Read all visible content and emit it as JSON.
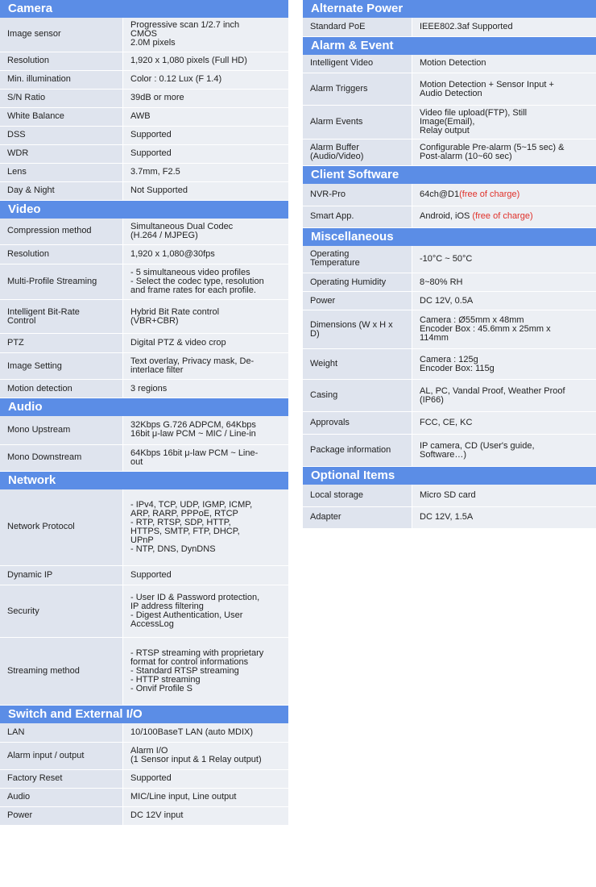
{
  "left_sections": [
    {
      "title": "Camera",
      "rows": [
        {
          "label": "Image sensor",
          "value": "Progressive scan 1/2.7 inch\nCMOS\n2.0M pixels",
          "h": 42
        },
        {
          "label": "Resolution",
          "value": "1,920 x 1,080 pixels (Full HD)",
          "h": 23
        },
        {
          "label": "Min. illumination",
          "value": "Color : 0.12 Lux (F 1.4)",
          "h": 23
        },
        {
          "label": "S/N Ratio",
          "value": "39dB or more",
          "h": 23
        },
        {
          "label": "White Balance",
          "value": "AWB",
          "h": 23
        },
        {
          "label": "DSS",
          "value": "Supported",
          "h": 23
        },
        {
          "label": "WDR",
          "value": "Supported",
          "h": 23
        },
        {
          "label": "Lens",
          "value": "3.7mm,  F2.5",
          "h": 23
        },
        {
          "label": "Day & Night",
          "value": "Not Supported",
          "h": 23
        }
      ]
    },
    {
      "title": "Video",
      "rows": [
        {
          "label": "Compression method",
          "value": "Simultaneous Dual Codec\n (H.264 / MJPEG)",
          "h": 33
        },
        {
          "label": "Resolution",
          "value": "1,920 x 1,080@30fps",
          "h": 24
        },
        {
          "label": "Multi-Profile Streaming",
          "value": "- 5 simultaneous video profiles\n- Select the codec type, resolution\n  and frame rates for each profile.",
          "h": 44
        },
        {
          "label": "Intelligent Bit-Rate\nControl",
          "value": "Hybrid Bit Rate control\n(VBR+CBR)",
          "h": 42
        },
        {
          "label": "PTZ",
          "value": "Digital PTZ  &  video crop",
          "h": 24
        },
        {
          "label": "Image Setting",
          "value": "Text overlay, Privacy mask, De-\ninterlace filter",
          "h": 33
        },
        {
          "label": "Motion detection",
          "value": "3 regions",
          "h": 23
        }
      ]
    },
    {
      "title": "Audio",
      "rows": [
        {
          "label": "Mono Upstream",
          "value": "32Kbps G.726 ADPCM, 64Kbps\n16bit μ-law PCM  ~ MIC / Line-in",
          "h": 35
        },
        {
          "label": "Mono Downstream",
          "value": "64Kbps 16bit μ-law PCM ~ Line-\nout",
          "h": 33
        }
      ]
    },
    {
      "title": "Network",
      "rows": [
        {
          "label": "Network Protocol",
          "value": "- IPv4,  TCP,  UDP,  IGMP,  ICMP,\n  ARP,  RARP,  PPPoE,  RTCP\n- RTP,  RTSP,  SDP,  HTTP,\n  HTTPS,  SMTP,  FTP,  DHCP,\n  UPnP\n- NTP,  DNS,  DynDNS",
          "h": 95
        },
        {
          "label": "Dynamic IP",
          "value": "Supported",
          "h": 24
        },
        {
          "label": "Security",
          "value": "- User ID  & Password protection,\n  IP address filtering\n- Digest Authentication, User\n  AccessLog",
          "h": 65
        },
        {
          "label": "Streaming method",
          "value": "- RTSP  streaming with proprietary\n  format for control informations\n- Standard RTSP  streaming\n- HTTP  streaming\n- Onvif Profile  S",
          "h": 84
        }
      ]
    },
    {
      "title": "Switch and External I/O",
      "rows": [
        {
          "label": "LAN",
          "value": "10/100BaseT LAN (auto MDIX)",
          "h": 23
        },
        {
          "label": "Alarm input / output",
          "value": "Alarm I/O\n(1 Sensor input & 1 Relay output)",
          "h": 34
        },
        {
          "label": "Factory Reset",
          "value": "Supported",
          "h": 23
        },
        {
          "label": "Audio",
          "value": "MIC/Line  input, Line output",
          "h": 23
        },
        {
          "label": "Power",
          "value": "DC  12V input",
          "h": 23
        }
      ]
    }
  ],
  "right_sections": [
    {
      "title": "Alternate Power",
      "rows": [
        {
          "label": "Standard PoE",
          "value": "IEEE802.3af  Supported",
          "h": 23
        }
      ]
    },
    {
      "title": "Alarm & Event",
      "rows": [
        {
          "label": "Intelligent Video",
          "value": "Motion Detection",
          "h": 23
        },
        {
          "label": "Alarm Triggers",
          "value": "Motion Detection + Sensor Input +\nAudio Detection",
          "h": 40
        },
        {
          "label": "Alarm Events",
          "value": "Video file upload(FTP),  Still\nImage(Email),\nRelay output",
          "h": 42
        },
        {
          "label": "Alarm Buffer\n(Audio/Video)",
          "value": "Configurable Pre-alarm (5~15 sec) &\nPost-alarm (10~60 sec)",
          "h": 33
        }
      ]
    },
    {
      "title": "Client Software",
      "rows": [
        {
          "label": "NVR-Pro",
          "value": "64ch@D1",
          "note": "(free of charge)",
          "h": 27
        },
        {
          "label": "Smart App.",
          "value": "Android, iOS ",
          "note": "(free of charge)",
          "h": 27
        }
      ]
    },
    {
      "title": "Miscellaneous",
      "rows": [
        {
          "label": "Operating\nTemperature",
          "value": "-10°C ~ 50°C",
          "h": 34
        },
        {
          "label": "Operating Humidity",
          "value": "8~80% RH",
          "h": 23
        },
        {
          "label": "Power",
          "value": "DC 12V, 0.5A",
          "h": 23
        },
        {
          "label": "Dimensions (W x H x\nD)",
          "value": "Camera : Ø55mm x 48mm\nEncoder Box : 45.6mm x 25mm x\n114mm",
          "h": 48
        },
        {
          "label": "Weight",
          "value": "Camera : 125g\nEncoder Box: 115g",
          "h": 38
        },
        {
          "label": "Casing",
          "value": "AL, PC,  Vandal Proof, Weather Proof\n(IP66)",
          "h": 40
        },
        {
          "label": "Approvals",
          "value": "FCC,  CE,  KC",
          "h": 28
        },
        {
          "label": "Package information",
          "value": "IP camera, CD (User's guide,\nSoftware…)",
          "h": 40
        }
      ]
    },
    {
      "title": "Optional Items",
      "rows": [
        {
          "label": "Local storage",
          "value": "Micro SD card",
          "h": 27
        },
        {
          "label": "Adapter",
          "value": "DC  12V, 1.5A",
          "h": 27
        }
      ]
    }
  ]
}
